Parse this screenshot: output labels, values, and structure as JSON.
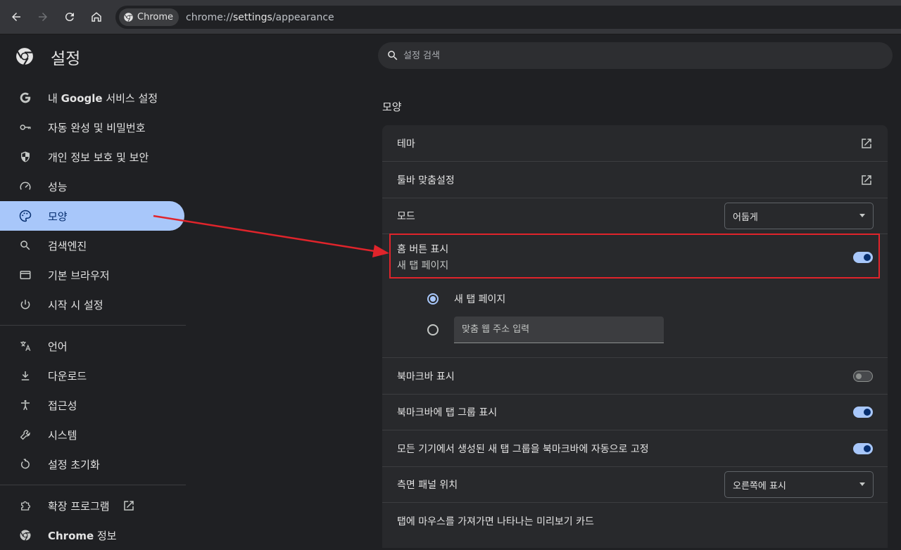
{
  "browser": {
    "chip_label": "Chrome",
    "url_prefix": "chrome://",
    "url_host": "settings",
    "url_path": "/appearance"
  },
  "header": {
    "title": "설정",
    "search_placeholder": "설정 검색"
  },
  "sidebar": {
    "items": [
      {
        "label_bold": "",
        "label_pre": "내 ",
        "label_mid": "Google",
        "label_post": " 서비스 설정",
        "icon": "google-icon"
      },
      {
        "label": "자동 완성 및 비밀번호",
        "icon": "key-icon"
      },
      {
        "label": "개인 정보 보호 및 보안",
        "icon": "shield-icon"
      },
      {
        "label": "성능",
        "icon": "speedometer-icon"
      },
      {
        "label": "모양",
        "icon": "palette-icon",
        "active": true
      },
      {
        "label": "검색엔진",
        "icon": "search-icon"
      },
      {
        "label": "기본 브라우저",
        "icon": "browser-window-icon"
      },
      {
        "label": "시작 시 설정",
        "icon": "power-icon"
      },
      {
        "label": "언어",
        "icon": "translate-icon"
      },
      {
        "label": "다운로드",
        "icon": "download-icon"
      },
      {
        "label": "접근성",
        "icon": "accessibility-icon"
      },
      {
        "label": "시스템",
        "icon": "wrench-icon"
      },
      {
        "label": "설정 초기화",
        "icon": "reset-icon"
      },
      {
        "label": "확장 프로그램",
        "icon": "extension-icon"
      },
      {
        "label_mid": "Chrome",
        "label_post": " 정보",
        "icon": "chrome-icon"
      }
    ]
  },
  "main": {
    "section_title": "모양",
    "rows": {
      "theme": "테마",
      "toolbar_custom": "툴바 맞춤설정",
      "mode": "모드",
      "mode_value": "어둡게",
      "home_button": "홈 버튼 표시",
      "home_button_sub": "새 탭 페이지",
      "radio_new_tab": "새 탭 페이지",
      "custom_url_placeholder": "맞춤 웹 주소 입력",
      "bookmarks_bar": "북마크바 표시",
      "bookmarks_tab_groups": "북마크바에 탭 그룹 표시",
      "auto_pin_tab_groups": "모든 기기에서 생성된 새 탭 그룹을 북마크바에 자동으로 고정",
      "side_panel": "측면 패널 위치",
      "side_panel_value": "오른쪽에 표시",
      "hover_preview": "탭에 마우스를 가져가면 나타나는 미리보기 카드"
    },
    "toggles": {
      "home_button": true,
      "bookmarks_bar": false,
      "bookmarks_tab_groups": true,
      "auto_pin_tab_groups": true
    }
  },
  "colors": {
    "accent": "#a8c7fa",
    "annotation": "#e0242b",
    "background": "#1f2023",
    "card": "#28292c"
  }
}
